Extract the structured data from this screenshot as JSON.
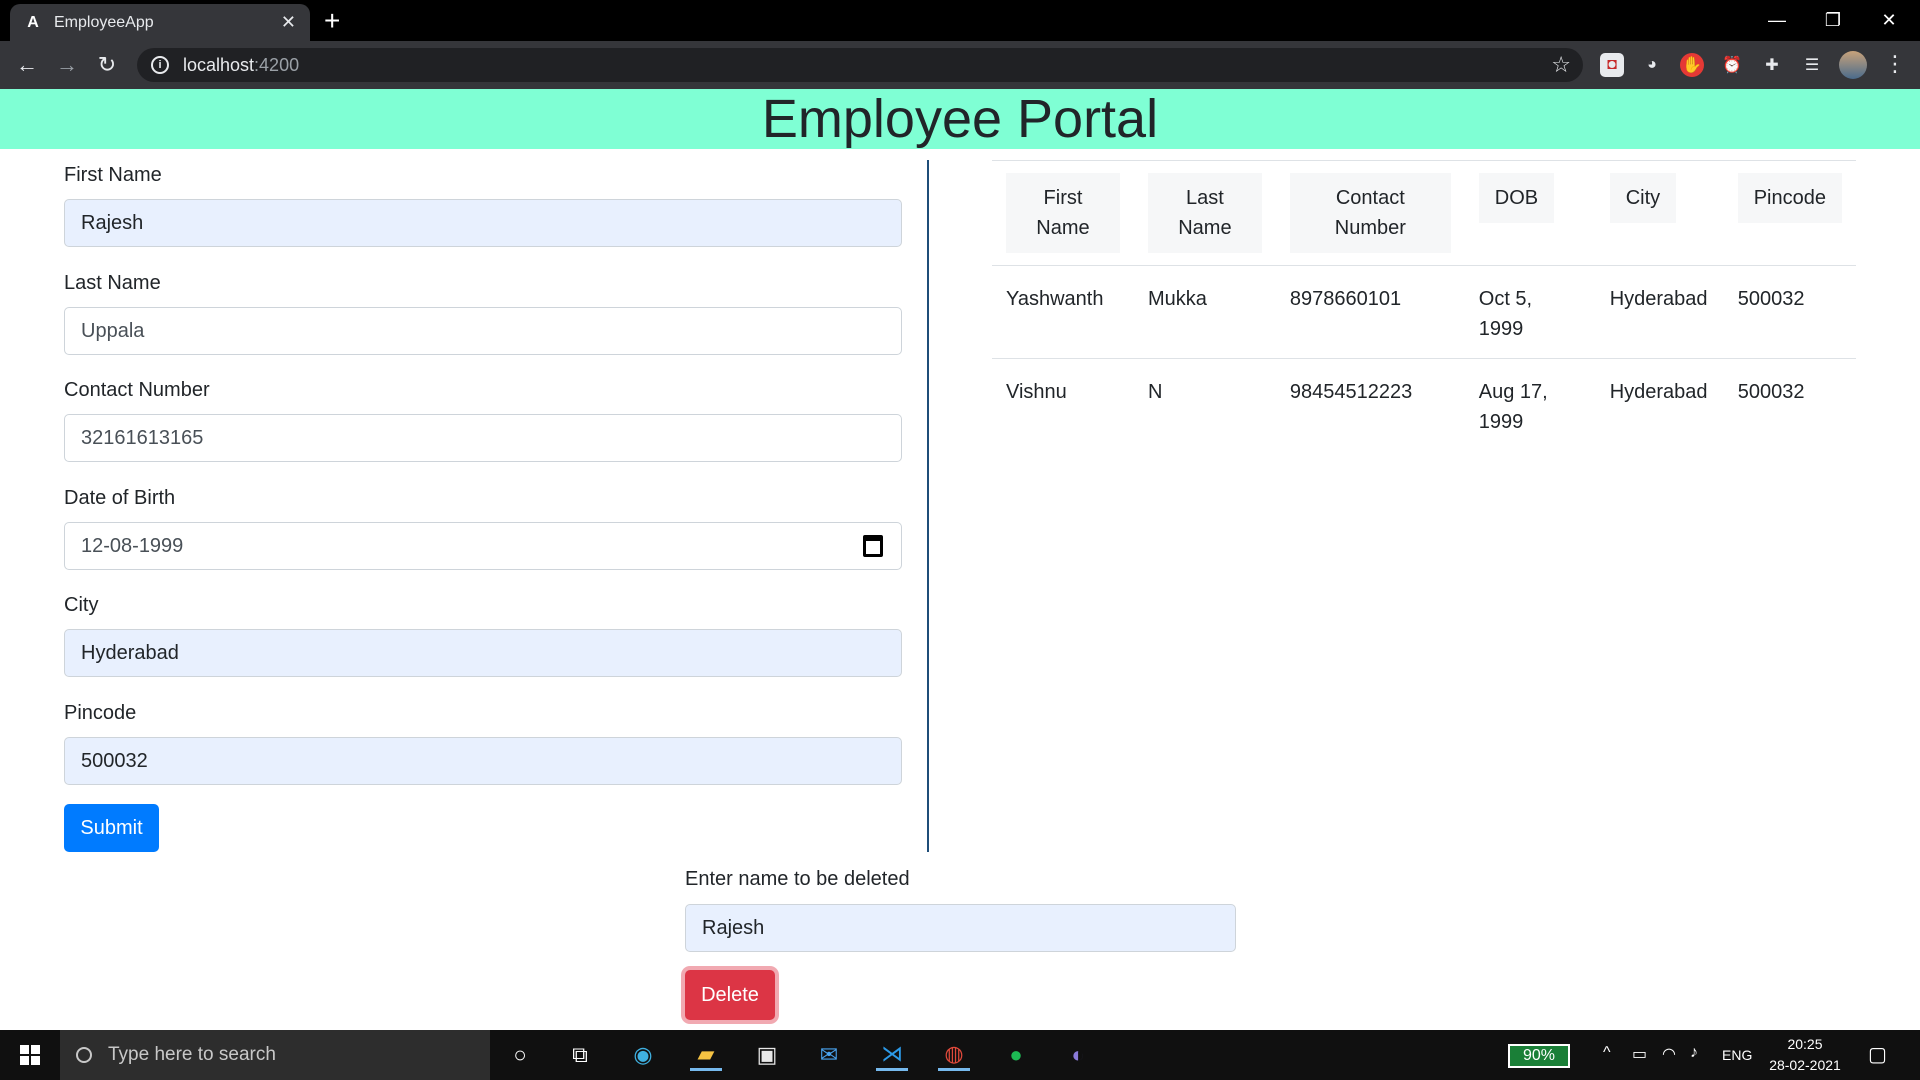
{
  "browser": {
    "tab_title": "EmployeeApp",
    "tab_favicon": "A",
    "url_host": "localhost",
    "url_port": ":4200"
  },
  "page": {
    "title": "Employee Portal"
  },
  "form": {
    "first_name_label": "First Name",
    "first_name_value": "Rajesh",
    "last_name_label": "Last Name",
    "last_name_value": "Uppala",
    "contact_label": "Contact Number",
    "contact_value": "32161613165",
    "dob_label": "Date of Birth",
    "dob_value": "12-08-1999",
    "city_label": "City",
    "city_value": "Hyderabad",
    "pincode_label": "Pincode",
    "pincode_value": "500032",
    "submit_label": "Submit"
  },
  "table": {
    "headers": [
      "First Name",
      "Last Name",
      "Contact Number",
      "DOB",
      "City",
      "Pincode"
    ],
    "rows": [
      [
        "Yashwanth",
        "Mukka",
        "8978660101",
        "Oct 5, 1999",
        "Hyderabad",
        "500032"
      ],
      [
        "Vishnu",
        "N",
        "98454512223",
        "Aug 17, 1999",
        "Hyderabad",
        "500032"
      ]
    ]
  },
  "delete": {
    "label": "Enter name to be deleted",
    "value": "Rajesh",
    "button_label": "Delete"
  },
  "taskbar": {
    "search_placeholder": "Type here to search",
    "battery": "90%",
    "language": "ENG",
    "time": "20:25",
    "date": "28-02-2021"
  }
}
